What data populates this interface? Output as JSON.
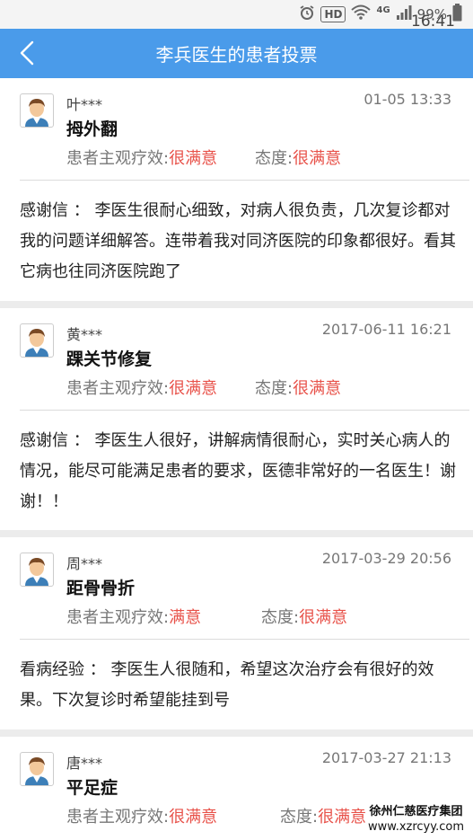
{
  "status_bar": {
    "hd": "HD",
    "signal_label": "4G",
    "battery": "99%",
    "time": "16:41"
  },
  "nav": {
    "title": "李兵医生的患者投票"
  },
  "reviews": [
    {
      "user": "叶***",
      "time": "01-05 13:33",
      "disease": "拇外翻",
      "efficacy_label": "患者主观疗效:",
      "efficacy": "很满意",
      "attitude_label": "态度:",
      "attitude": "很满意",
      "text": "感谢信 ： 李医生很耐心细致，对病人很负责，几次复诊都对我的问题详细解答。连带着我对同济医院的印象都很好。看其它病也往同济医院跑了"
    },
    {
      "user": "黄***",
      "time": "2017-06-11 16:21",
      "disease": "踝关节修复",
      "efficacy_label": "患者主观疗效:",
      "efficacy": "很满意",
      "attitude_label": "态度:",
      "attitude": "很满意",
      "text": "感谢信 ： 李医生人很好，讲解病情很耐心，实时关心病人的情况，能尽可能满足患者的要求，医德非常好的一名医生！谢谢！！"
    },
    {
      "user": "周***",
      "time": "2017-03-29 20:56",
      "disease": "距骨骨折",
      "efficacy_label": "患者主观疗效:",
      "efficacy": "满意",
      "attitude_label": "态度:",
      "attitude": "很满意",
      "text": "看病经验 ： 李医生人很随和，希望这次治疗会有很好的效果。下次复诊时希望能挂到号"
    },
    {
      "user": "唐***",
      "time": "2017-03-27 21:13",
      "disease": "平足症",
      "efficacy_label": "患者主观疗效:",
      "efficacy": "很满意",
      "attitude_label": "态度:",
      "attitude": "很满意",
      "text": ""
    }
  ],
  "watermark": {
    "line1": "徐州仁慈医疗集团",
    "line2": "www.xzrcyy.com"
  },
  "colors": {
    "nav": "#4a9bea",
    "rating": "#e8524a",
    "separator": "#ececec"
  }
}
